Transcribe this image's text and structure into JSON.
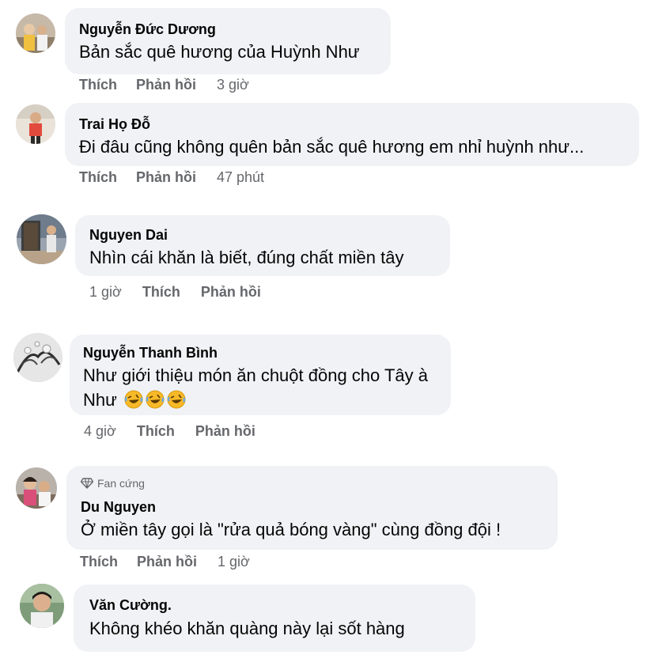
{
  "comments": [
    {
      "name": "Nguyễn Đức Dương",
      "text": "Bản sắc quê hương của Huỳnh Như",
      "like": "Thích",
      "reply": "Phản hồi",
      "time": "3 giờ"
    },
    {
      "name": "Trai Họ Đỗ",
      "text": "Đi đâu cũng không quên bản sắc quê hương em nhỉ huỳnh như...",
      "like": "Thích",
      "reply": "Phản hồi",
      "time": "47 phút"
    },
    {
      "name": "Nguyen Dai",
      "text": "Nhìn cái khăn là biết, đúng chất miền tây",
      "time": "1 giờ",
      "like": "Thích",
      "reply": "Phản hồi"
    },
    {
      "name": "Nguyễn Thanh Bình",
      "text_line1": "Như giới thiệu món ăn chuột đồng cho Tây à",
      "text_line2": "Như",
      "emojis": [
        "rolling-laughing-emoji",
        "rolling-laughing-emoji",
        "rolling-laughing-emoji"
      ],
      "time": "4 giờ",
      "like": "Thích",
      "reply": "Phản hồi"
    },
    {
      "badge": "Fan cứng",
      "badge_icon": "diamond-icon",
      "name": "Du Nguyen",
      "text": "Ở miền tây gọi là \"rửa quả bóng vàng\" cùng đồng đội !",
      "like": "Thích",
      "reply": "Phản hồi",
      "time": "1 giờ"
    },
    {
      "name": "Văn Cường.",
      "text": "Không khéo khăn quàng này lại sốt hàng"
    }
  ],
  "colors": {
    "bubble": "#f0f2f5",
    "secondary_text": "#65676b",
    "primary_text": "#050505",
    "emoji_face": "#f7b928"
  }
}
